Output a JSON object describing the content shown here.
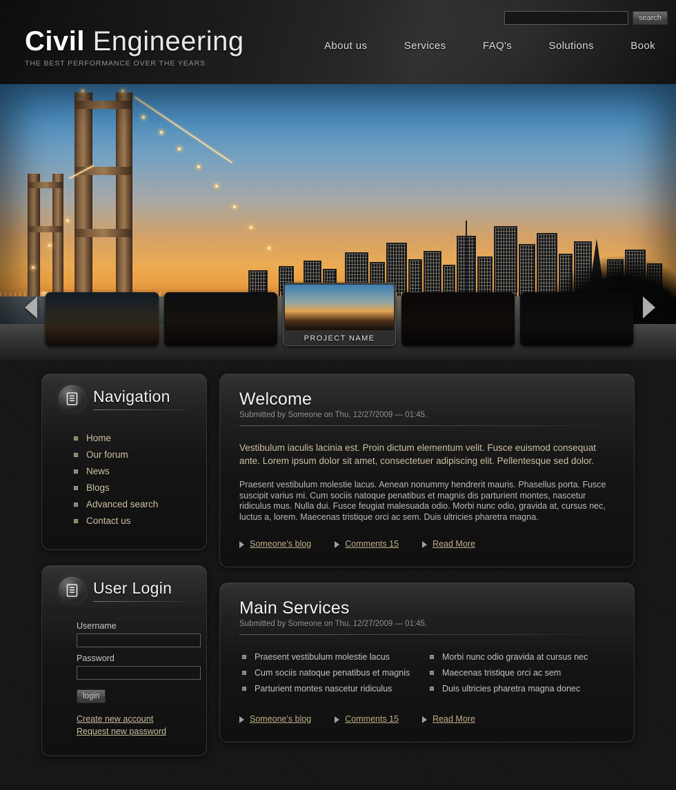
{
  "header": {
    "logo_bold": "Civil",
    "logo_light": " Engineering",
    "tagline": "THE BEST PERFORMANCE OVER THE YEARS",
    "search": {
      "value": "",
      "placeholder": "",
      "button_label": "search"
    },
    "nav": [
      {
        "label": "About us"
      },
      {
        "label": "Services"
      },
      {
        "label": "FAQ's"
      },
      {
        "label": "Solutions"
      },
      {
        "label": "Book"
      }
    ]
  },
  "carousel": {
    "prev_label": "◀",
    "next_label": "▶",
    "active_index": 2,
    "thumbs": [
      {
        "caption": "",
        "scene": "sc1"
      },
      {
        "caption": "",
        "scene": "sc2"
      },
      {
        "caption": "PROJECT NAME",
        "scene": "sc3"
      },
      {
        "caption": "",
        "scene": "sc4"
      },
      {
        "caption": "",
        "scene": "sc5"
      }
    ]
  },
  "sidebar": {
    "navigation": {
      "icon": "document-list-icon",
      "title": "Navigation",
      "items": [
        {
          "label": "Home"
        },
        {
          "label": "Our forum"
        },
        {
          "label": "News"
        },
        {
          "label": "Blogs"
        },
        {
          "label": "Advanced search"
        },
        {
          "label": "Contact us"
        }
      ]
    },
    "login": {
      "icon": "document-list-icon",
      "title": "User Login",
      "username_label": "Username",
      "username_value": "",
      "password_label": "Password",
      "password_value": "",
      "submit_label": "login",
      "links": [
        {
          "label": "Create new account"
        },
        {
          "label": "Request new password"
        }
      ]
    }
  },
  "content": {
    "welcome": {
      "title": "Welcome",
      "submitted": "Submitted by Someone on Thu, 12/27/2009 — 01:45.",
      "lead": "Vestibulum iaculis lacinia est. Proin dictum elementum velit. Fusce euismod consequat ante. Lorem ipsum dolor sit amet, consectetuer adipiscing elit. Pellentesque sed dolor.",
      "body": "Praesent vestibulum molestie lacus. Aenean nonummy hendrerit mauris. Phasellus porta. Fusce suscipit varius mi. Cum sociis natoque penatibus et magnis dis parturient montes, nascetur ridiculus mus. Nulla dui. Fusce feugiat malesuada odio. Morbi nunc odio, gravida at, cursus nec, luctus a, lorem. Maecenas tristique orci ac sem. Duis ultricies pharetra magna.",
      "links": [
        {
          "label": "Someone's blog"
        },
        {
          "label": "Comments 15"
        },
        {
          "label": "Read More"
        }
      ]
    },
    "services": {
      "title": "Main Services",
      "submitted": "Submitted by Someone on Thu, 12/27/2009 — 01:45.",
      "column_left": [
        {
          "label": "Praesent vestibulum molestie lacus"
        },
        {
          "label": "Cum sociis natoque penatibus et magnis"
        },
        {
          "label": "Parturient montes nascetur ridiculus"
        }
      ],
      "column_right": [
        {
          "label": "Morbi nunc odio gravida at cursus nec"
        },
        {
          "label": "Maecenas tristique orci ac sem"
        },
        {
          "label": "Duis ultricies pharetra magna donec"
        }
      ],
      "links": [
        {
          "label": "Someone's blog"
        },
        {
          "label": "Comments 15"
        },
        {
          "label": "Read More"
        }
      ]
    }
  },
  "colors": {
    "page_background": "#161616",
    "panel_background": "#141414",
    "link_accent": "#bfae86",
    "nav_link": "#cdbf9f",
    "heading": "#f2f2f2",
    "muted_text": "#8e8e8e"
  }
}
